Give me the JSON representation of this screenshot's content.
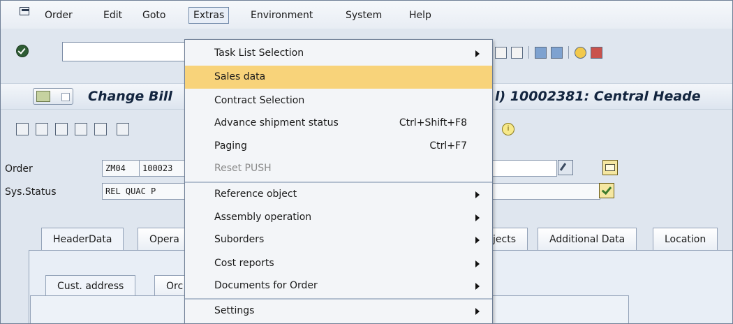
{
  "menubar": {
    "items": [
      "Order",
      "Edit",
      "Goto",
      "Extras",
      "Environment",
      "System",
      "Help"
    ],
    "open_item": "Extras"
  },
  "title": {
    "left": "Change Bill",
    "right": "l) 10002381: Central Heade"
  },
  "header": {
    "order_label": "Order",
    "order_type": "ZM04",
    "order_number": "100023",
    "status_label": "Sys.Status",
    "status_value": "REL  QUAC P"
  },
  "tabs": [
    "HeaderData",
    "Opera",
    "jects",
    "Additional Data",
    "Location"
  ],
  "subtabs": [
    "Cust. address",
    "Orc"
  ],
  "extras_menu": [
    {
      "label": "Task List Selection",
      "shortcut": "",
      "submenu": true,
      "highlighted": false,
      "disabled": false
    },
    {
      "label": "Sales data",
      "shortcut": "",
      "submenu": false,
      "highlighted": true,
      "disabled": false
    },
    {
      "label": "Contract Selection",
      "shortcut": "",
      "submenu": false,
      "highlighted": false,
      "disabled": false
    },
    {
      "label": "Advance shipment status",
      "shortcut": "Ctrl+Shift+F8",
      "submenu": false,
      "highlighted": false,
      "disabled": false
    },
    {
      "label": "Paging",
      "shortcut": "Ctrl+F7",
      "submenu": false,
      "highlighted": false,
      "disabled": false
    },
    {
      "label": "Reset PUSH",
      "shortcut": "",
      "submenu": false,
      "highlighted": false,
      "disabled": true
    },
    {
      "label": "Reference object",
      "shortcut": "",
      "submenu": true,
      "highlighted": false,
      "disabled": false
    },
    {
      "label": "Assembly operation",
      "shortcut": "",
      "submenu": true,
      "highlighted": false,
      "disabled": false
    },
    {
      "label": "Suborders",
      "shortcut": "",
      "submenu": true,
      "highlighted": false,
      "disabled": false
    },
    {
      "label": "Cost reports",
      "shortcut": "",
      "submenu": true,
      "highlighted": false,
      "disabled": false
    },
    {
      "label": "Documents for Order",
      "shortcut": "",
      "submenu": true,
      "highlighted": false,
      "disabled": false
    },
    {
      "label": "Settings",
      "shortcut": "",
      "submenu": true,
      "highlighted": false,
      "disabled": false
    }
  ],
  "icons": {
    "system_menu": "system-menu-icon",
    "enter": "enter-checkmark-icon",
    "info": "info-icon"
  },
  "colors": {
    "highlight": "#f8d37a",
    "background": "#dfe6ef"
  }
}
